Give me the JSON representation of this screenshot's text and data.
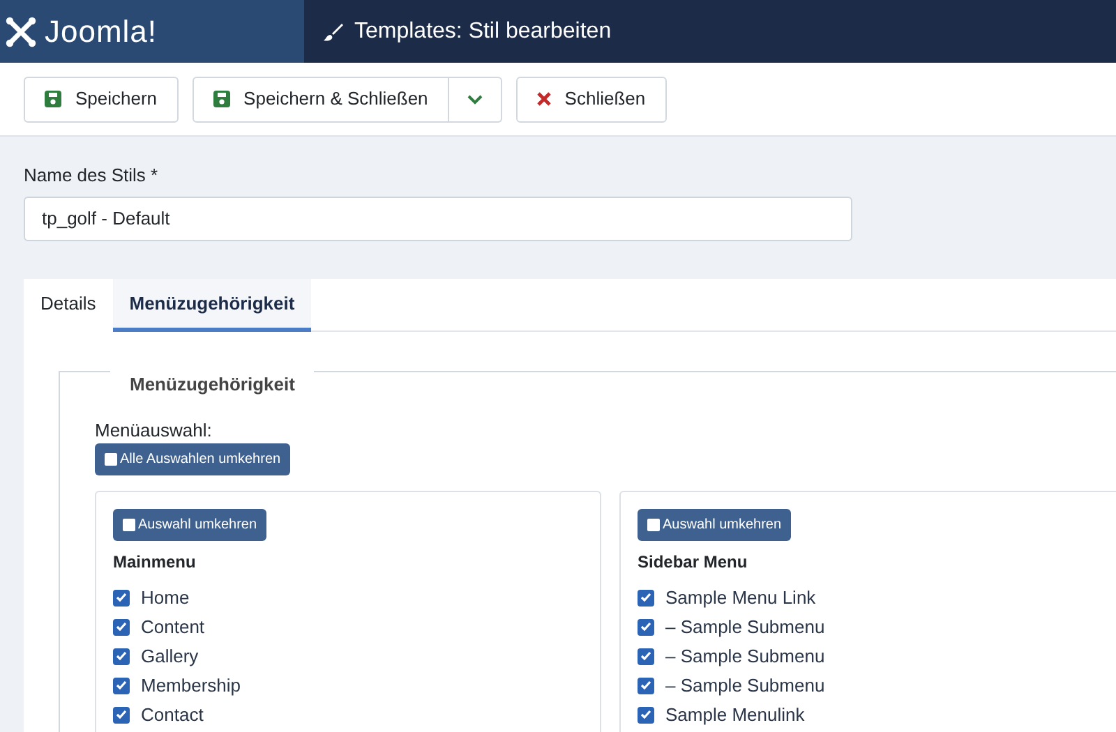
{
  "header": {
    "logo_text": "Joomla!",
    "title": "Templates: Stil bearbeiten"
  },
  "toolbar": [
    {
      "kind": "save",
      "label": "Speichern"
    },
    {
      "kind": "save-split",
      "label": "Speichern & Schließen"
    },
    {
      "kind": "close",
      "label": "Schließen"
    }
  ],
  "style_name": {
    "label": "Name des Stils *",
    "value": "tp_golf - Default"
  },
  "tabs": [
    {
      "label": "Details",
      "selected": false
    },
    {
      "label": "Menüzugehörigkeit",
      "selected": true
    }
  ],
  "fieldset": {
    "legend": "Menüzugehörigkeit",
    "selection_label": "Menüauswahl:",
    "toggle_all": {
      "label": "Alle Auswahlen umkehren",
      "checked": false
    },
    "menus": [
      {
        "toggle": {
          "label": "Auswahl umkehren",
          "checked": false
        },
        "title": "Mainmenu",
        "items": [
          {
            "label": "Home",
            "checked": true
          },
          {
            "label": "Content",
            "checked": true
          },
          {
            "label": "Gallery",
            "checked": true
          },
          {
            "label": "Membership",
            "checked": true
          },
          {
            "label": "Contact",
            "checked": true
          }
        ]
      },
      {
        "toggle": {
          "label": "Auswahl umkehren",
          "checked": false
        },
        "title": "Sidebar Menu",
        "items": [
          {
            "label": "Sample Menu Link",
            "checked": true
          },
          {
            "label": "– Sample Submenu",
            "checked": true
          },
          {
            "label": "– Sample Submenu",
            "checked": true
          },
          {
            "label": "– Sample Submenu",
            "checked": true
          },
          {
            "label": "Sample Menulink",
            "checked": true
          }
        ]
      }
    ]
  }
}
